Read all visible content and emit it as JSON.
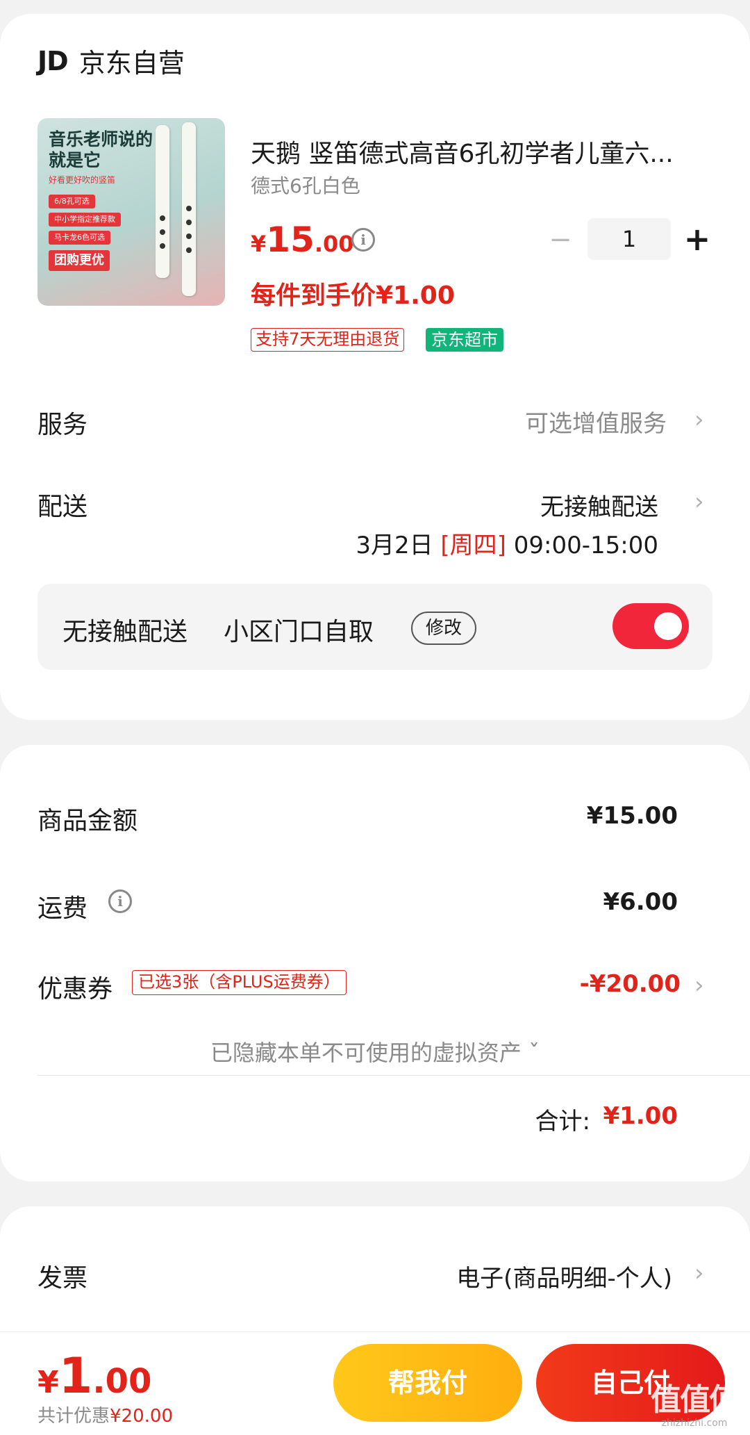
{
  "store": {
    "logo": "JD",
    "name": "京东自营"
  },
  "product": {
    "image_title": "音乐老师说的就是它",
    "image_subtitle": "好看更好吹的竖笛",
    "image_tags": [
      "6/8孔可选",
      "中小学指定推荐款",
      "马卡龙6色可选",
      "团购更优"
    ],
    "title": "天鹅 竖笛德式高音6孔初学者儿童六...",
    "spec": "德式6孔白色",
    "price_yen": "¥",
    "price_int": "15",
    "price_dec": ".00",
    "quantity": "1",
    "unit_price_label": "每件到手价¥1.00",
    "tags": [
      "支持7天无理由退货",
      "京东超市"
    ]
  },
  "service": {
    "label": "服务",
    "value": "可选增值服务"
  },
  "delivery": {
    "label": "配送",
    "value": "无接触配送",
    "date": "3月2日 ",
    "weekday": "[周四]",
    "time": " 09:00-15:00"
  },
  "contactless": {
    "label": "无接触配送",
    "spot": "小区门口自取",
    "edit_label": "修改",
    "enabled": true
  },
  "costs": {
    "goods_label": "商品金额",
    "goods_value": "¥15.00",
    "shipping_label": "运费",
    "shipping_value": "¥6.00",
    "coupon_label": "优惠券",
    "coupon_tag": "已选3张（含PLUS运费券）",
    "coupon_value": "-¥20.00",
    "hidden_note": "已隐藏本单不可使用的虚拟资产 ˇ",
    "total_label": "合计:",
    "total_value": "¥1.00"
  },
  "invoice": {
    "label": "发票",
    "value": "电子(商品明细-个人)"
  },
  "bottom": {
    "total_yen": "¥",
    "total_int": "1",
    "total_dec": ".00",
    "saving_label": "共计优惠",
    "saving_value": "¥20.00",
    "help_pay_label": "帮我付",
    "self_pay_label": "自己付"
  },
  "watermark": {
    "text": "值值值",
    "sub": "zhizhizhi.com"
  },
  "colors": {
    "accent_red": "#e2231a",
    "toggle_on": "#f2263a",
    "market_green": "#11b57a",
    "help_button": "#ffb815"
  }
}
